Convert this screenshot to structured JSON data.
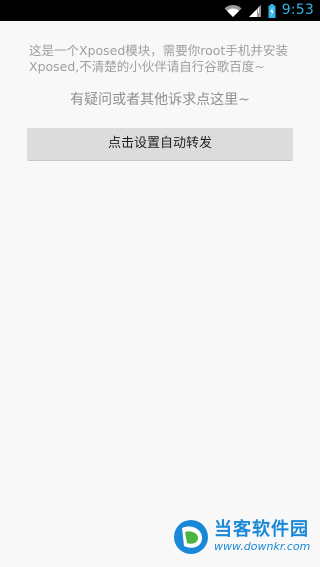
{
  "status_bar": {
    "time": "9:53",
    "icons": [
      "wifi-icon",
      "signal-icon",
      "battery-charging-icon"
    ],
    "time_color": "#33b5e5"
  },
  "main": {
    "intro_text": "这是一个Xposed模块，需要你root手机并安装Xposed,不清楚的小伙伴请自行谷歌百度~",
    "help_link": "有疑问或者其他诉求点这里~",
    "action_button_label": "点击设置自动转发"
  },
  "watermark": {
    "title": "当客软件园",
    "url": "www.downkr.com"
  },
  "colors": {
    "background": "#f8f8f8",
    "status_bar": "#000000",
    "button": "#dcdcdc",
    "muted_text": "#9e9e9e",
    "watermark_blue": "#1a88d8"
  }
}
